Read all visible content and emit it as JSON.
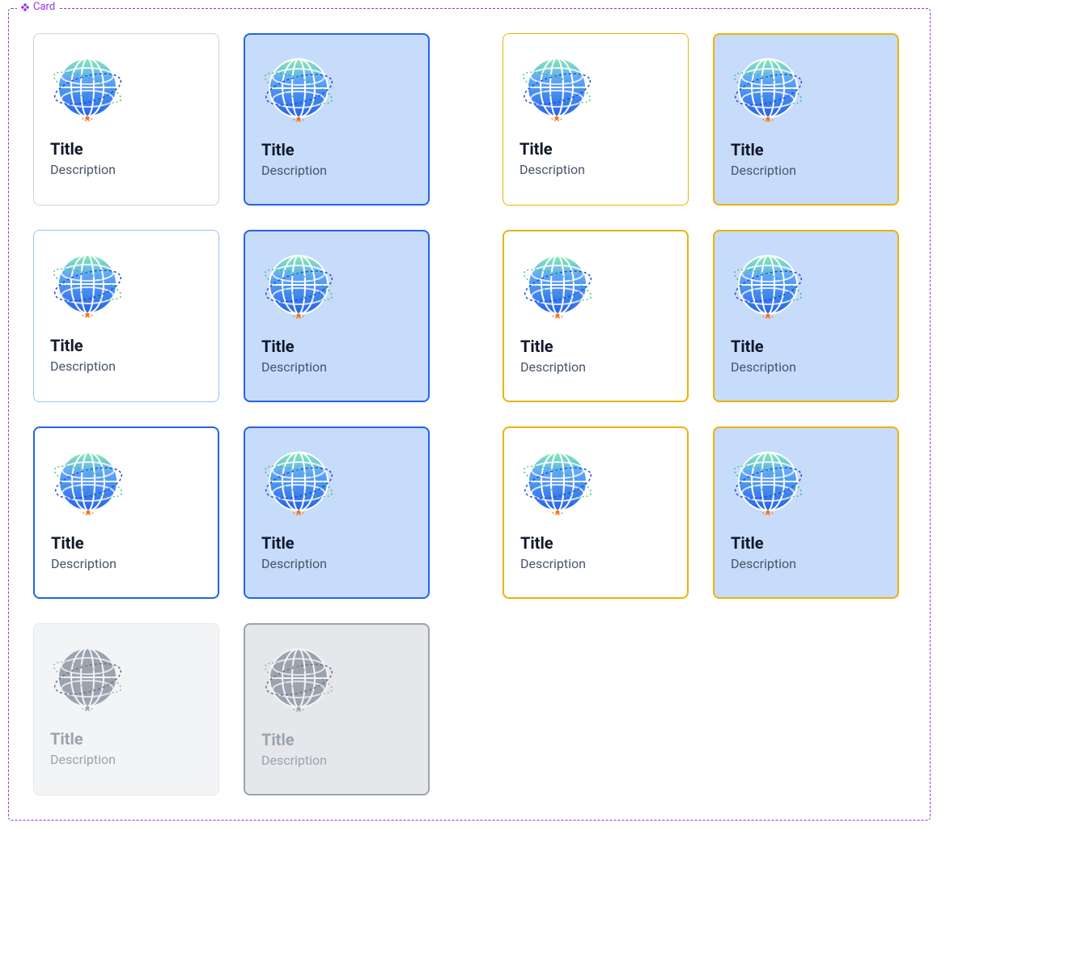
{
  "frame_label": "Card",
  "colors": {
    "frame_border": "#9333ea",
    "selected_bg": "#c7dbfb",
    "blue_border": "#2563eb",
    "yellow_border": "#eab308",
    "light_blue_border": "#93c5fd",
    "disabled_bg": "#f3f4f6",
    "disabled_border": "#e5e7eb",
    "disabled_sel_border": "#9ca3af"
  },
  "rows": [
    {
      "left": [
        {
          "variant": "c-default",
          "title": "Title",
          "desc": "Description",
          "grayscale": false
        },
        {
          "variant": "c-sel-blue",
          "title": "Title",
          "desc": "Description",
          "grayscale": false
        }
      ],
      "right": [
        {
          "variant": "c-hover-y",
          "title": "Title",
          "desc": "Description",
          "grayscale": false
        },
        {
          "variant": "c-hover-ys",
          "title": "Title",
          "desc": "Description",
          "grayscale": false
        }
      ]
    },
    {
      "left": [
        {
          "variant": "c-lite-b",
          "title": "Title",
          "desc": "Description",
          "grayscale": false
        },
        {
          "variant": "c-sel-blue",
          "title": "Title",
          "desc": "Description",
          "grayscale": false
        }
      ],
      "right": [
        {
          "variant": "c-y2",
          "title": "Title",
          "desc": "Description",
          "grayscale": false
        },
        {
          "variant": "c-y2s",
          "title": "Title",
          "desc": "Description",
          "grayscale": false
        }
      ]
    },
    {
      "left": [
        {
          "variant": "c-b2",
          "title": "Title",
          "desc": "Description",
          "grayscale": false
        },
        {
          "variant": "c-sel-blue",
          "title": "Title",
          "desc": "Description",
          "grayscale": false
        }
      ],
      "right": [
        {
          "variant": "c-y2",
          "title": "Title",
          "desc": "Description",
          "grayscale": false
        },
        {
          "variant": "c-y2s",
          "title": "Title",
          "desc": "Description",
          "grayscale": false
        }
      ]
    },
    {
      "left": [
        {
          "variant": "c-dis",
          "title": "Title",
          "desc": "Description",
          "grayscale": true
        },
        {
          "variant": "c-dis-s",
          "title": "Title",
          "desc": "Description",
          "grayscale": true
        }
      ],
      "right": []
    }
  ]
}
